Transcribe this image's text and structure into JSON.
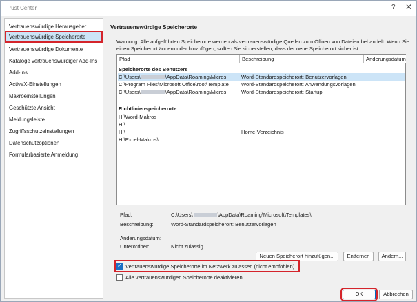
{
  "window": {
    "title": "Trust Center",
    "help_label": "?",
    "close_label": "✕"
  },
  "sidebar": {
    "items": [
      {
        "label": "Vertrauenswürdige Herausgeber"
      },
      {
        "label": "Vertrauenswürdige Speicherorte",
        "selected": true
      },
      {
        "label": "Vertrauenswürdige Dokumente"
      },
      {
        "label": "Kataloge vertrauenswürdiger Add-Ins"
      },
      {
        "label": "Add-Ins"
      },
      {
        "label": "ActiveX-Einstellungen"
      },
      {
        "label": "Makroeinstellungen"
      },
      {
        "label": "Geschützte Ansicht"
      },
      {
        "label": "Meldungsleiste"
      },
      {
        "label": "Zugriffsschutzeinstellungen"
      },
      {
        "label": "Datenschutzoptionen"
      },
      {
        "label": "Formularbasierte Anmeldung"
      }
    ]
  },
  "main": {
    "title": "Vertrauenswürdige Speicherorte",
    "warning": "Warnung: Alle aufgeführten Speicherorte werden als vertrauenswürdige Quellen zum Öffnen von Dateien behandelt. Wenn Sie einen Speicherort ändern oder hinzufügen, sollten Sie sicherstellen, dass der neue Speicherort sicher ist."
  },
  "list": {
    "columns": [
      "Pfad",
      "Beschreibung",
      "Änderungsdatum"
    ],
    "user_section": "Speicherorte des Benutzers",
    "user_rows": [
      {
        "path_prefix": "C:\\Users\\",
        "path_suffix": "\\AppData\\Roaming\\Micros",
        "description": "Word-Standardspeicherort: Benutzervorlagen",
        "selected": true
      },
      {
        "path_prefix": "C:\\Program Files\\Microsoft Office\\root\\Template",
        "path_suffix": "",
        "description": "Word-Standardspeicherort: Anwendungsvorlagen"
      },
      {
        "path_prefix": "C:\\Users\\",
        "path_suffix": "\\AppData\\Roaming\\Micros",
        "description": "Word-Standardspeicherort: Startup"
      }
    ],
    "policy_section": "Richtlinienspeicherorte",
    "policy_rows": [
      {
        "path": "H:\\Word-Makros",
        "description": ""
      },
      {
        "path": "H:\\",
        "description": ""
      },
      {
        "path": "H:\\",
        "description": "Home-Verzeichnis"
      },
      {
        "path": "H:\\Excel-Makros\\",
        "description": ""
      }
    ]
  },
  "details": {
    "path_label": "Pfad:",
    "path_prefix": "C:\\Users\\",
    "path_suffix": "\\AppData\\Roaming\\Microsoft\\Templates\\",
    "desc_label": "Beschreibung:",
    "desc_value": "Word-Standardspeicherort: Benutzervorlagen",
    "date_label": "Änderungsdatum:",
    "date_value": "",
    "sub_label": "Unterordner:",
    "sub_value": "Nicht zulässig"
  },
  "buttons": {
    "add": "Neuen Speicherort hinzufügen...",
    "remove": "Entfernen",
    "modify": "Ändern...",
    "ok": "OK",
    "cancel": "Abbrechen"
  },
  "checkboxes": {
    "network": {
      "label": "Vertrauenswürdige Speicherorte im Netzwerk zulassen (nicht empfohlen)",
      "checked": true
    },
    "disable_all": {
      "label": "Alle vertrauenswürdigen Speicherorte deaktivieren",
      "checked": false
    }
  },
  "colors": {
    "selection": "#cce4f7",
    "highlight": "#d4242b",
    "checkbox_accent": "#1b6fc4"
  }
}
